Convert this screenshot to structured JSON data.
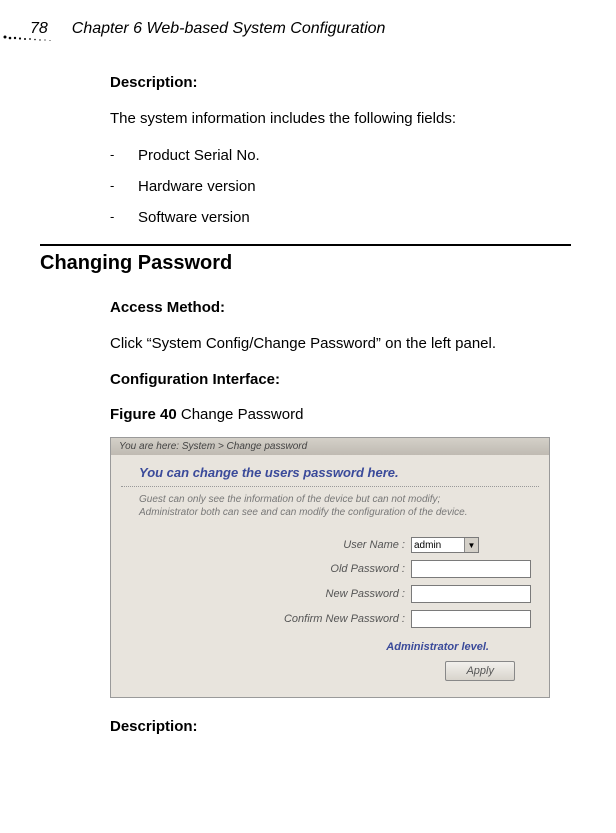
{
  "header": {
    "page_number": "78",
    "chapter_title": "Chapter 6 Web-based System Configuration"
  },
  "description_heading": "Description:",
  "intro_text": "The system information includes the following fields:",
  "bullets": [
    "Product Serial No.",
    "Hardware version",
    "Software version"
  ],
  "section_heading": "Changing Password",
  "access_method_heading": "Access Method:",
  "access_method_text": "Click “System Config/Change Password” on the left panel.",
  "config_interface_heading": "Configuration Interface:",
  "figure": {
    "prefix": "Figure 40",
    "caption": "  Change Password"
  },
  "screenshot": {
    "breadcrumb": "You are here: System > Change password",
    "title": "You can change the users password here.",
    "subtitle_line1": "Guest can only see the information of the device but can not modify;",
    "subtitle_line2": "Administrator both can see and can modify the configuration of the device.",
    "labels": {
      "username": "User Name :",
      "old_password": "Old Password :",
      "new_password": "New Password :",
      "confirm_password": "Confirm New Password :"
    },
    "username_value": "admin",
    "admin_level": "Administrator level.",
    "apply": "Apply"
  },
  "description_bottom": "Description:"
}
